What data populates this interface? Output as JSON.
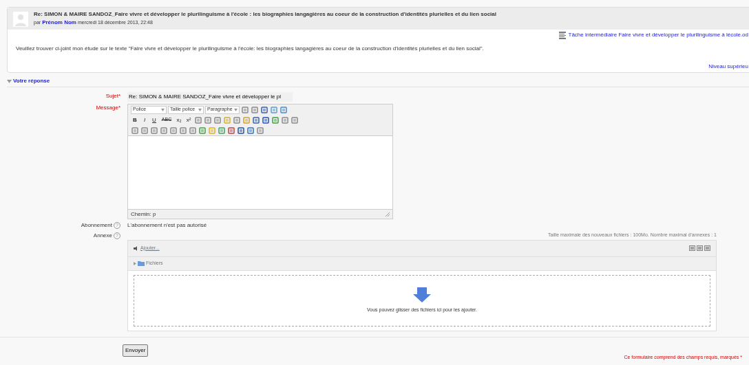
{
  "post": {
    "subject": "Re: SIMON & MAIRE SANDOZ_Faire vivre et développer le plurilinguisme à l'école : les biographies langagières au coeur de la construction d'identités plurielles et du lien social",
    "by": "par",
    "author": "Prénom Nom",
    "date": "mercredi 18 décembre 2013, 22:48",
    "attachment": "Tâche intermédiaire Faire vivre et développer le plurilinguisme à lécole.od",
    "message": "Veuillez trouver ci-joint mon étude sur le texte \"Faire vivre et développer le plurilinguisme à l'école: les biographies langagières au coeur de la construction d'identités plurielles et du lien social\".",
    "parent_link": "Niveau supérieu"
  },
  "form": {
    "legend": "Votre réponse",
    "expanded": true,
    "subject": {
      "label": "Sujet",
      "value": "Re: SIMON & MAIRE SANDOZ_Faire vivre et développer le pl"
    },
    "message": {
      "label": "Message",
      "selects": [
        "Police",
        "Taille police",
        "Paragraphe"
      ],
      "toolbar": [
        [
          {
            "kind": "icon"
          },
          {
            "kind": "icon"
          },
          {
            "kind": "icon"
          },
          {
            "kind": "icon"
          },
          {
            "kind": "icon"
          }
        ],
        [
          {
            "kind": "text",
            "label": "B"
          },
          {
            "kind": "text",
            "label": "I"
          },
          {
            "kind": "text",
            "label": "U"
          },
          {
            "kind": "text",
            "label": "ABC"
          },
          {
            "kind": "text",
            "label": "x₂"
          },
          {
            "kind": "text",
            "label": "x²"
          },
          {
            "kind": "icon"
          },
          {
            "kind": "icon"
          },
          {
            "kind": "icon"
          },
          {
            "kind": "icon"
          },
          {
            "kind": "icon"
          },
          {
            "kind": "icon"
          },
          {
            "kind": "icon"
          },
          {
            "kind": "icon"
          },
          {
            "kind": "icon"
          },
          {
            "kind": "icon"
          },
          {
            "kind": "icon"
          }
        ],
        [
          {
            "kind": "icon"
          },
          {
            "kind": "icon"
          },
          {
            "kind": "icon"
          },
          {
            "kind": "icon"
          },
          {
            "kind": "icon"
          },
          {
            "kind": "icon"
          },
          {
            "kind": "icon"
          },
          {
            "kind": "icon"
          },
          {
            "kind": "icon"
          },
          {
            "kind": "icon"
          },
          {
            "kind": "icon"
          },
          {
            "kind": "icon"
          },
          {
            "kind": "icon"
          },
          {
            "kind": "icon"
          }
        ]
      ],
      "path": "Chemin: p"
    },
    "subscription": {
      "label": "Abonnement",
      "help": "?",
      "value": "L'abonnement n'est pas autorisé"
    },
    "attachment": {
      "label": "Annexe",
      "help": "?",
      "limits": "Taille maximale des nouveaux fichiers : 100Mo. Nombre maximal d'annexes : 1",
      "add": "Ajouter...",
      "folder": "Fichiers",
      "drop_hint": "Vous pouvez glisser des fichiers ici pour les ajouter."
    },
    "submit": "Envoyer",
    "required_note": "Ce formulaire comprend des champs requis, marqués",
    "required_mark": "*"
  }
}
